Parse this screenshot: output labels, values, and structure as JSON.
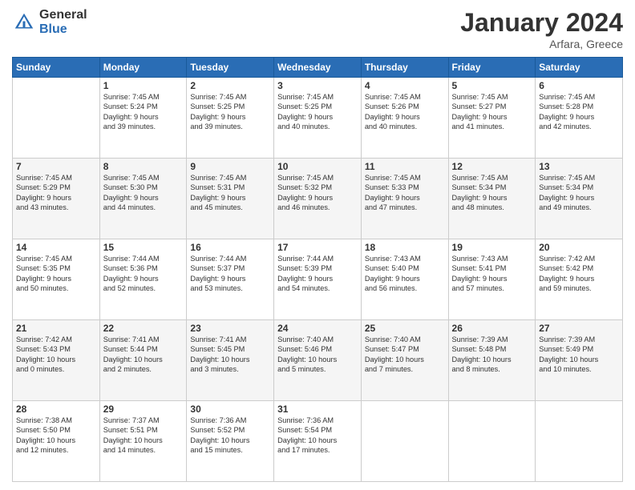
{
  "header": {
    "logo_general": "General",
    "logo_blue": "Blue",
    "month_title": "January 2024",
    "subtitle": "Arfara, Greece"
  },
  "days_of_week": [
    "Sunday",
    "Monday",
    "Tuesday",
    "Wednesday",
    "Thursday",
    "Friday",
    "Saturday"
  ],
  "weeks": [
    [
      {
        "day": "",
        "content": ""
      },
      {
        "day": "1",
        "content": "Sunrise: 7:45 AM\nSunset: 5:24 PM\nDaylight: 9 hours\nand 39 minutes."
      },
      {
        "day": "2",
        "content": "Sunrise: 7:45 AM\nSunset: 5:25 PM\nDaylight: 9 hours\nand 39 minutes."
      },
      {
        "day": "3",
        "content": "Sunrise: 7:45 AM\nSunset: 5:25 PM\nDaylight: 9 hours\nand 40 minutes."
      },
      {
        "day": "4",
        "content": "Sunrise: 7:45 AM\nSunset: 5:26 PM\nDaylight: 9 hours\nand 40 minutes."
      },
      {
        "day": "5",
        "content": "Sunrise: 7:45 AM\nSunset: 5:27 PM\nDaylight: 9 hours\nand 41 minutes."
      },
      {
        "day": "6",
        "content": "Sunrise: 7:45 AM\nSunset: 5:28 PM\nDaylight: 9 hours\nand 42 minutes."
      }
    ],
    [
      {
        "day": "7",
        "content": "Sunrise: 7:45 AM\nSunset: 5:29 PM\nDaylight: 9 hours\nand 43 minutes."
      },
      {
        "day": "8",
        "content": "Sunrise: 7:45 AM\nSunset: 5:30 PM\nDaylight: 9 hours\nand 44 minutes."
      },
      {
        "day": "9",
        "content": "Sunrise: 7:45 AM\nSunset: 5:31 PM\nDaylight: 9 hours\nand 45 minutes."
      },
      {
        "day": "10",
        "content": "Sunrise: 7:45 AM\nSunset: 5:32 PM\nDaylight: 9 hours\nand 46 minutes."
      },
      {
        "day": "11",
        "content": "Sunrise: 7:45 AM\nSunset: 5:33 PM\nDaylight: 9 hours\nand 47 minutes."
      },
      {
        "day": "12",
        "content": "Sunrise: 7:45 AM\nSunset: 5:34 PM\nDaylight: 9 hours\nand 48 minutes."
      },
      {
        "day": "13",
        "content": "Sunrise: 7:45 AM\nSunset: 5:34 PM\nDaylight: 9 hours\nand 49 minutes."
      }
    ],
    [
      {
        "day": "14",
        "content": "Sunrise: 7:45 AM\nSunset: 5:35 PM\nDaylight: 9 hours\nand 50 minutes."
      },
      {
        "day": "15",
        "content": "Sunrise: 7:44 AM\nSunset: 5:36 PM\nDaylight: 9 hours\nand 52 minutes."
      },
      {
        "day": "16",
        "content": "Sunrise: 7:44 AM\nSunset: 5:37 PM\nDaylight: 9 hours\nand 53 minutes."
      },
      {
        "day": "17",
        "content": "Sunrise: 7:44 AM\nSunset: 5:39 PM\nDaylight: 9 hours\nand 54 minutes."
      },
      {
        "day": "18",
        "content": "Sunrise: 7:43 AM\nSunset: 5:40 PM\nDaylight: 9 hours\nand 56 minutes."
      },
      {
        "day": "19",
        "content": "Sunrise: 7:43 AM\nSunset: 5:41 PM\nDaylight: 9 hours\nand 57 minutes."
      },
      {
        "day": "20",
        "content": "Sunrise: 7:42 AM\nSunset: 5:42 PM\nDaylight: 9 hours\nand 59 minutes."
      }
    ],
    [
      {
        "day": "21",
        "content": "Sunrise: 7:42 AM\nSunset: 5:43 PM\nDaylight: 10 hours\nand 0 minutes."
      },
      {
        "day": "22",
        "content": "Sunrise: 7:41 AM\nSunset: 5:44 PM\nDaylight: 10 hours\nand 2 minutes."
      },
      {
        "day": "23",
        "content": "Sunrise: 7:41 AM\nSunset: 5:45 PM\nDaylight: 10 hours\nand 3 minutes."
      },
      {
        "day": "24",
        "content": "Sunrise: 7:40 AM\nSunset: 5:46 PM\nDaylight: 10 hours\nand 5 minutes."
      },
      {
        "day": "25",
        "content": "Sunrise: 7:40 AM\nSunset: 5:47 PM\nDaylight: 10 hours\nand 7 minutes."
      },
      {
        "day": "26",
        "content": "Sunrise: 7:39 AM\nSunset: 5:48 PM\nDaylight: 10 hours\nand 8 minutes."
      },
      {
        "day": "27",
        "content": "Sunrise: 7:39 AM\nSunset: 5:49 PM\nDaylight: 10 hours\nand 10 minutes."
      }
    ],
    [
      {
        "day": "28",
        "content": "Sunrise: 7:38 AM\nSunset: 5:50 PM\nDaylight: 10 hours\nand 12 minutes."
      },
      {
        "day": "29",
        "content": "Sunrise: 7:37 AM\nSunset: 5:51 PM\nDaylight: 10 hours\nand 14 minutes."
      },
      {
        "day": "30",
        "content": "Sunrise: 7:36 AM\nSunset: 5:52 PM\nDaylight: 10 hours\nand 15 minutes."
      },
      {
        "day": "31",
        "content": "Sunrise: 7:36 AM\nSunset: 5:54 PM\nDaylight: 10 hours\nand 17 minutes."
      },
      {
        "day": "",
        "content": ""
      },
      {
        "day": "",
        "content": ""
      },
      {
        "day": "",
        "content": ""
      }
    ]
  ]
}
